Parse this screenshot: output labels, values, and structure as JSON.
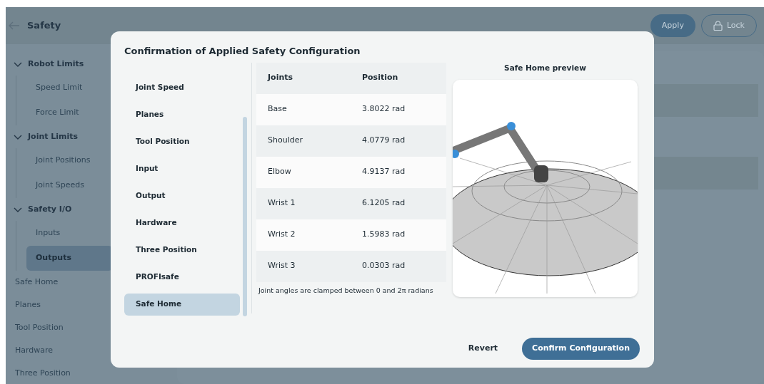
{
  "app": {
    "title": "Safety",
    "buttons": [
      {
        "label": "Apply",
        "kind": "text"
      },
      {
        "label": "Lock",
        "kind": "lock"
      }
    ]
  },
  "sidebar": {
    "items": [
      {
        "label": "Robot Limits",
        "kind": "group",
        "expanded": true,
        "selected": false,
        "children": [
          {
            "label": "Speed Limit",
            "selected": false
          },
          {
            "label": "Force Limit",
            "selected": false
          }
        ]
      },
      {
        "label": "Joint Limits",
        "kind": "group",
        "expanded": true,
        "selected": false,
        "children": [
          {
            "label": "Joint Positions",
            "selected": false
          },
          {
            "label": "Joint Speeds",
            "selected": false
          }
        ]
      },
      {
        "label": "Safety I/O",
        "kind": "group",
        "expanded": true,
        "selected": false,
        "children": [
          {
            "label": "Inputs",
            "selected": false
          },
          {
            "label": "Outputs",
            "selected": true
          }
        ]
      },
      {
        "label": "Safe Home",
        "kind": "leaf",
        "selected": false
      },
      {
        "label": "Planes",
        "kind": "leaf",
        "selected": false
      },
      {
        "label": "Tool Position",
        "kind": "leaf",
        "selected": false
      },
      {
        "label": "Hardware",
        "kind": "leaf",
        "selected": false
      },
      {
        "label": "Three Position",
        "kind": "leaf",
        "selected": false
      }
    ]
  },
  "dialog": {
    "title": "Confirmation of Applied Safety Configuration",
    "sections": [
      {
        "label": "Joint Speed",
        "selected": false
      },
      {
        "label": "Planes",
        "selected": false
      },
      {
        "label": "Tool Position",
        "selected": false
      },
      {
        "label": "Input",
        "selected": false
      },
      {
        "label": "Output",
        "selected": false
      },
      {
        "label": "Hardware",
        "selected": false
      },
      {
        "label": "Three Position",
        "selected": false
      },
      {
        "label": "PROFIsafe",
        "selected": false
      },
      {
        "label": "Safe Home",
        "selected": true
      }
    ],
    "table": {
      "columns": [
        "Joints",
        "Position"
      ],
      "rows": [
        [
          "Base",
          "3.8022 rad"
        ],
        [
          "Shoulder",
          "4.0779 rad"
        ],
        [
          "Elbow",
          "4.9137 rad"
        ],
        [
          "Wrist 1",
          "6.1205 rad"
        ],
        [
          "Wrist 2",
          "1.5983 rad"
        ],
        [
          "Wrist 3",
          "0.0303 rad"
        ]
      ]
    },
    "note": "Joint angles are clamped between 0 and 2π radians",
    "preview": {
      "title": "Safe Home preview"
    },
    "buttons": [
      {
        "label": "Revert",
        "kind": "secondary"
      },
      {
        "label": "Confirm Configuration",
        "kind": "primary"
      }
    ]
  }
}
